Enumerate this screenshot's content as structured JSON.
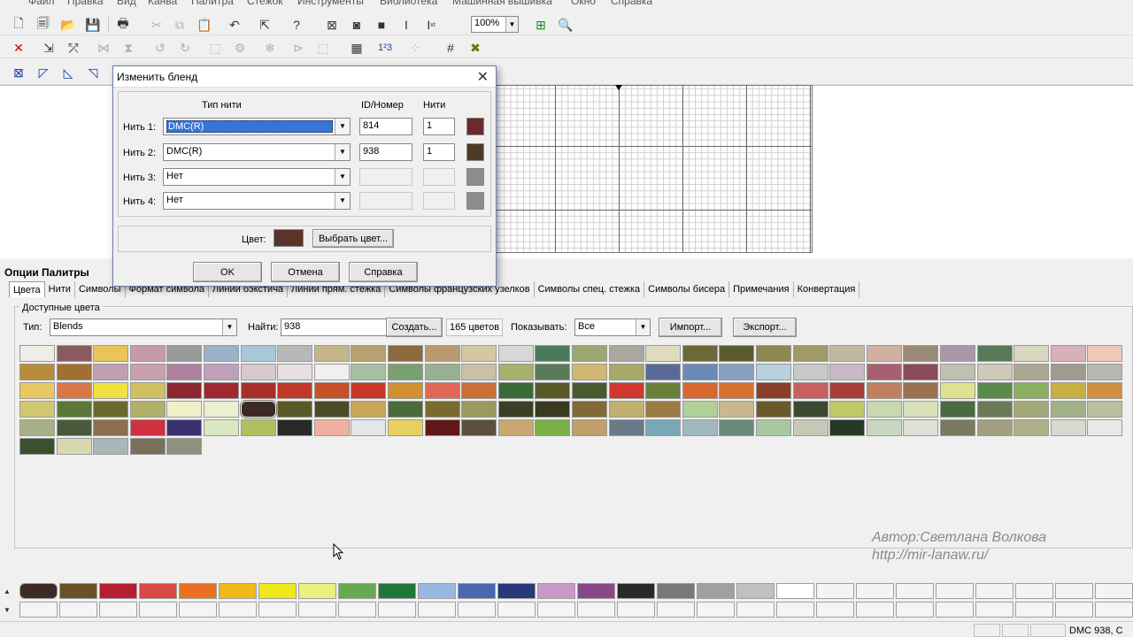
{
  "menu": [
    "Файл",
    "Правка",
    "Вид",
    "Канва",
    "Палитра",
    "Стежок",
    "Инструменты",
    "Библиотека",
    "Машинная вышивка",
    "Окно",
    "Справка"
  ],
  "toolbar": {
    "zoom": "100%"
  },
  "dialog": {
    "title": "Изменить бленд",
    "col_type": "Тип нити",
    "col_id": "ID/Номер",
    "col_strands": "Нити",
    "rows": [
      {
        "label": "Нить 1:",
        "type": "DMC(R)",
        "id": "814",
        "strands": "1",
        "color": "#6b2a2c",
        "selected": true
      },
      {
        "label": "Нить 2:",
        "type": "DMC(R)",
        "id": "938",
        "strands": "1",
        "color": "#4a3a26"
      },
      {
        "label": "Нить 3:",
        "type": "Нет",
        "id": "",
        "strands": "",
        "color": "#8c8c8c"
      },
      {
        "label": "Нить 4:",
        "type": "Нет",
        "id": "",
        "strands": "",
        "color": "#8c8c8c"
      }
    ],
    "color_label": "Цвет:",
    "blend_color": "#5a3329",
    "choose_color_label": "Выбрать цвет...",
    "ok": "OK",
    "cancel": "Отмена",
    "help": "Справка"
  },
  "palette_panel": {
    "title": "Опции Палитры",
    "tabs": [
      "Цвета",
      "Нити",
      "Символы",
      "Формат символа",
      "Линии бэкстича",
      "Линии прям. стежка",
      "Символы французских узелков",
      "Символы спец. стежка",
      "Символы бисера",
      "Примечания",
      "Конвертация"
    ],
    "group_label": "Доступные цвета",
    "type_label": "Тип:",
    "type_value": "Blends",
    "find_label": "Найти:",
    "find_value": "938",
    "create_button": "Создать...",
    "count": "165 цветов",
    "show_label": "Показывать:",
    "show_value": "Все",
    "import_button": "Импорт...",
    "export_button": "Экспорт...",
    "swatches": [
      [
        "#eeeee6",
        "#8b5a61",
        "#e9c45a",
        "#c79aa8",
        "#9a9a9a",
        "#9bb3c8",
        "#a8c8d8",
        "#b8b8b8",
        "#c5b58a",
        "#b8a070",
        "#8b6a40",
        "#b89a70",
        "#d4c8a0",
        "#d8d8d8",
        "#4a7a5a",
        "#9aa870",
        "#a8a8a0",
        "#e0dcc0",
        "#6a6a38",
        "#5a5a30",
        "#8c8850",
        "#a09a6a",
        "#c0b8a0",
        "#d0b0a0",
        "#9a8878",
        "#a898a8",
        "#587a58",
        "#d8d8c0",
        "#d8b0b8",
        "#f0c8b8"
      ],
      [
        "#b88c3a",
        "#a07030",
        "#c0a0b0",
        "#c8a0b0",
        "#b080a0",
        "#c0a0b8",
        "#d8c8d0",
        "#e8e0e0",
        "#f0f0f0",
        "#a8c0a0",
        "#78a070",
        "#98b090",
        "#c8c0a8",
        "#a8b070",
        "#5a7a58",
        "#d0b870",
        "#a8a868",
        "#5a6a98",
        "#6a8ab8",
        "#88a0c0",
        "#b8d0e0",
        "#c8c8c8",
        "#c8b8c8",
        "#a86070",
        "#8a4a58",
        "#c0c0b0",
        "#d0c8b8",
        "#a8a890",
        "#a09a90",
        "#b8b8b0"
      ],
      [
        "#e8c860",
        "#d87848",
        "#f0e040",
        "#d0c060",
        "#8c2830",
        "#a02830",
        "#a83028",
        "#c03828",
        "#c85028",
        "#c83828",
        "#d09030",
        "#e06858",
        "#c87038",
        "#3a6a38",
        "#5a5a28",
        "#4a5a30",
        "#d03830",
        "#6a8038",
        "#d86830",
        "#d87030",
        "#8a4028",
        "#c86060",
        "#a84038",
        "#c08060",
        "#9a7050",
        "#e0e090",
        "#5a8a48",
        "#88b060",
        "#c8b040",
        "#d09040"
      ],
      [
        "#d0c870",
        "#5a7838",
        "#6a6a30",
        "#b0b068",
        "#f0f0c8",
        "#e8f0d0",
        "#3e2a24",
        "#5a5a28",
        "#4a4a28",
        "#c8a858",
        "#4a6a3a",
        "#7a6a30",
        "#9a9a60",
        "#3a4028",
        "#3a3a20",
        "#806a38",
        "#c0b070",
        "#9a7a40",
        "#b0d098",
        "#c8b890",
        "#6a5a28",
        "#3a4a30",
        "#c0c868",
        "#c8d8b0",
        "#d8e0b8",
        "#4a6a40",
        "#6a7a58",
        "#a0a878",
        "#a0b088",
        "#b8c0a0"
      ],
      [
        "#a8b088",
        "#485a38",
        "#8a7050",
        "#d03040",
        "#3a3070",
        "#d8e8c0",
        "#b0c060",
        "#282828",
        "#f0b0a0",
        "#e0e8e8",
        "#e8d060",
        "#601818",
        "#5a5040",
        "#c8a870",
        "#78b048",
        "#c0a068",
        "#6a7a88",
        "#78a8b8",
        "#a0b8c0",
        "#6a8a78",
        "#a8c8a0",
        "#c8c8b8",
        "#283828",
        "#c8d8c0",
        "#e0e0d8",
        "#7a7a60",
        "#a0a080",
        "#b0b088",
        "#d8d8d0",
        "#e8e8e8"
      ],
      [
        "#3a5030",
        "#d8d8b0",
        "#a8b8b8",
        "#787058",
        "#909080"
      ]
    ],
    "selected_swatch_index": [
      3,
      6
    ]
  },
  "watermark": {
    "author": "Автор:Светлана Волкова",
    "url": "http://mir-lanaw.ru/"
  },
  "bottom_palette": {
    "colors": [
      "#3e2a24",
      "#6a5028",
      "#b81c30",
      "#d84848",
      "#e87020",
      "#f0b818",
      "#f0e818",
      "#e8f080",
      "#68a850",
      "#207838",
      "#98b8e0",
      "#4868b0",
      "#283878",
      "#c898c8",
      "#884888",
      "#282a28",
      "#787878",
      "#a0a0a0",
      "#c0c0c0",
      "#ffffff"
    ]
  },
  "status": {
    "text": "DMC  938, C"
  }
}
